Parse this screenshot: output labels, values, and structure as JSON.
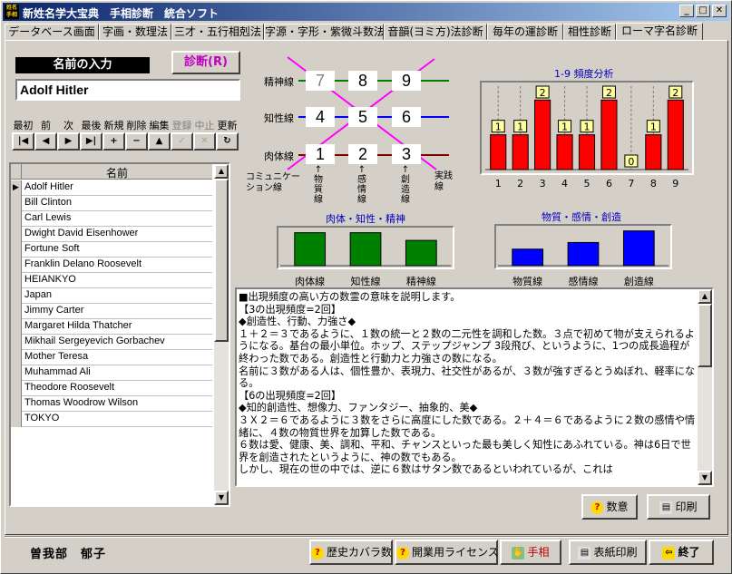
{
  "window": {
    "title": "新姓名学大宝典　手相診断　統合ソフト",
    "icon_text": "姓名手相"
  },
  "tabs": [
    {
      "label": "データベース画面",
      "active": false
    },
    {
      "label": "字画・数理法",
      "active": false
    },
    {
      "label": "三才・五行相剋法",
      "active": false
    },
    {
      "label": "字源・字形・紫微斗数法",
      "active": false
    },
    {
      "label": "音韻(ヨミ方)法診断",
      "active": false
    },
    {
      "label": "毎年の運診断",
      "active": false
    },
    {
      "label": "相性診断",
      "active": false
    },
    {
      "label": "ローマ字名診断",
      "active": true
    }
  ],
  "input": {
    "label": "名前の入力",
    "diagnose_button": "診断(R)",
    "value": "Adolf Hitler"
  },
  "nav": {
    "labels": [
      "最初",
      "前",
      "次",
      "最後",
      "新規",
      "削除",
      "編集",
      "登録",
      "中止",
      "更新"
    ],
    "icons": [
      "|◀",
      "◀",
      "▶",
      "▶|",
      "+",
      "−",
      "▲",
      "✓",
      "✕",
      "↻"
    ]
  },
  "list": {
    "header": "名前",
    "rows": [
      "Adolf Hitler",
      "Bill Clinton",
      "Carl Lewis",
      "Dwight David Eisenhower",
      "Fortune Soft",
      "Franklin Delano Roosevelt",
      "HEIANKYO",
      "Japan",
      "Jimmy Carter",
      "Margaret Hilda Thatcher",
      "Mikhail Sergeyevich Gorbachev",
      "Mother Teresa",
      "Muhammad Ali",
      "Theodore Roosevelt",
      "Thomas Woodrow Wilson",
      "TOKYO"
    ],
    "selected_index": 0
  },
  "grid": {
    "row_labels": [
      "精神線",
      "知性線",
      "肉体線"
    ],
    "rows": [
      [
        "7",
        "8",
        "9"
      ],
      [
        "4",
        "5",
        "6"
      ],
      [
        "1",
        "2",
        "3"
      ]
    ],
    "bottom_left": "コミュニケーション線",
    "col_labels": [
      "物質線",
      "感情線",
      "創造線"
    ],
    "bottom_right": "実践線",
    "line_colors": [
      "#008000",
      "#0000ff",
      "#800000"
    ],
    "diagonal_color": "#ff00ff"
  },
  "chart_data": [
    {
      "type": "bar",
      "title": "1-9 頻度分析",
      "categories": [
        "1",
        "2",
        "3",
        "4",
        "5",
        "6",
        "7",
        "8",
        "9"
      ],
      "values": [
        1,
        1,
        2,
        1,
        1,
        2,
        0,
        1,
        2
      ],
      "ylim": [
        0,
        2.4
      ],
      "bar_color": "#ff0000",
      "label_bg": "#ffffa0"
    },
    {
      "type": "bar",
      "title": "肉体・知性・精神",
      "categories": [
        "肉体線",
        "知性線",
        "精神線"
      ],
      "values": [
        3,
        3,
        2.3
      ],
      "ylim": [
        0,
        3.3
      ],
      "bar_color": "#008000"
    },
    {
      "type": "bar",
      "title": "物質・感情・創造",
      "categories": [
        "物質線",
        "感情線",
        "創造線"
      ],
      "values": [
        1,
        1.4,
        2.1
      ],
      "ylim": [
        0,
        2.3
      ],
      "bar_color": "#0000ff"
    }
  ],
  "text": [
    "■出現頻度の高い方の数霊の意味を説明します。",
    "【3の出現頻度=2回】",
    "◆創造性、行動、力強さ◆",
    "１＋２＝３であるように、１数の統一と２数の二元性を調和した数。３点で初めて物が支えられるようになる。基台の最小単位。ホップ、ステップジャンプ 3段飛び、というように、1つの成長過程が終わった数である。創造性と行動力と力強さの数になる。",
    "名前に３数がある人は、個性豊か、表現力、社交性があるが、３数が強すぎるとうぬぼれ、軽率になる。",
    "【6の出現頻度=2回】",
    "◆知的創造性、想像力、ファンタジー、抽象的、美◆",
    "３Ｘ２＝６であるように３数をさらに高度にした数である。２＋４＝６であるように２数の感情や情緒に、４数の物質世界を加算した数である。",
    "６数は愛、健康、美、調和、平和、チャンスといった最も美しく知性にあふれている。神は6日で世界を創造されたというように、神の数でもある。",
    "しかし、現在の世の中では、逆に６数はサタン数であるといわれているが、これは"
  ],
  "buttons": {
    "meaning": "数意",
    "print": "印刷",
    "history": "歴史カバラ数",
    "license": "開業用ライセンス",
    "palm": "手相",
    "cover_print": "表紙印刷",
    "exit": "終了"
  },
  "user": {
    "name": "曽我部　郁子"
  }
}
